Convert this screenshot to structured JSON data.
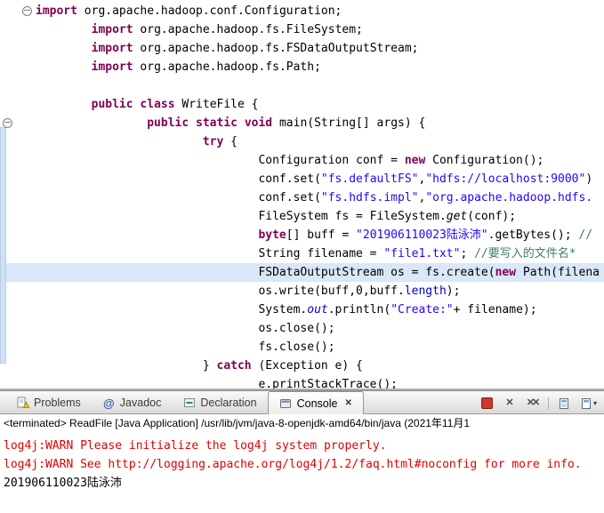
{
  "colors": {
    "kw": "#7f0055",
    "str": "#2a00ff",
    "com": "#3f7f5f",
    "stat": "#0000c0",
    "stderr": "#e00000",
    "stdout": "#000000",
    "hl": "#d9e7f8",
    "terminate": "#cc3b2e",
    "range": "#cfe0f4"
  },
  "editor": {
    "lines": [
      {
        "segments": [
          [
            "k",
            "import"
          ],
          [
            "p",
            " org.apache.hadoop.conf.Configuration;"
          ]
        ]
      },
      {
        "segments": [
          [
            "p",
            "        "
          ],
          [
            "k",
            "import"
          ],
          [
            "p",
            " org.apache.hadoop.fs.FileSystem;"
          ]
        ]
      },
      {
        "segments": [
          [
            "p",
            "        "
          ],
          [
            "k",
            "import"
          ],
          [
            "p",
            " org.apache.hadoop.fs.FSDataOutputStream;"
          ]
        ]
      },
      {
        "segments": [
          [
            "p",
            "        "
          ],
          [
            "k",
            "import"
          ],
          [
            "p",
            " org.apache.hadoop.fs.Path;"
          ]
        ]
      },
      {
        "segments": []
      },
      {
        "segments": [
          [
            "p",
            "        "
          ],
          [
            "k",
            "public"
          ],
          [
            "p",
            " "
          ],
          [
            "k",
            "class"
          ],
          [
            "p",
            " WriteFile {"
          ]
        ]
      },
      {
        "segments": [
          [
            "p",
            "                "
          ],
          [
            "k",
            "public"
          ],
          [
            "p",
            " "
          ],
          [
            "k",
            "static"
          ],
          [
            "p",
            " "
          ],
          [
            "k",
            "void"
          ],
          [
            "p",
            " main(String[] args) {"
          ]
        ]
      },
      {
        "segments": [
          [
            "p",
            "                        "
          ],
          [
            "k",
            "try"
          ],
          [
            "p",
            " {"
          ]
        ]
      },
      {
        "segments": [
          [
            "p",
            "                                Configuration conf = "
          ],
          [
            "k",
            "new"
          ],
          [
            "p",
            " Configuration();"
          ]
        ]
      },
      {
        "segments": [
          [
            "p",
            "                                conf.set("
          ],
          [
            "s",
            "\"fs.defaultFS\""
          ],
          [
            "p",
            ","
          ],
          [
            "s",
            "\"hdfs://localhost:9000\""
          ],
          [
            "p",
            ")"
          ]
        ]
      },
      {
        "segments": [
          [
            "p",
            "                                conf.set("
          ],
          [
            "s",
            "\"fs.hdfs.impl\""
          ],
          [
            "p",
            ","
          ],
          [
            "s",
            "\"org.apache.hadoop.hdfs."
          ]
        ]
      },
      {
        "segments": [
          [
            "p",
            "                                FileSystem fs = FileSystem."
          ],
          [
            "m",
            "get"
          ],
          [
            "p",
            "(conf);"
          ]
        ]
      },
      {
        "segments": [
          [
            "p",
            "                                "
          ],
          [
            "k",
            "byte"
          ],
          [
            "p",
            "[] buff = "
          ],
          [
            "s",
            "\"201906110023陆泳沛\""
          ],
          [
            "p",
            ".getBytes(); "
          ],
          [
            "c",
            "//"
          ]
        ]
      },
      {
        "segments": [
          [
            "p",
            "                                String filename = "
          ],
          [
            "s",
            "\"file1.txt\""
          ],
          [
            "p",
            "; "
          ],
          [
            "c",
            "//要写入的文件名*"
          ]
        ]
      },
      {
        "highlight": true,
        "segments": [
          [
            "p",
            "                                FSDataOutputStream os = fs.create("
          ],
          [
            "k",
            "new"
          ],
          [
            "p",
            " Path(filena"
          ]
        ]
      },
      {
        "segments": [
          [
            "p",
            "                                os.write(buff,0,buff."
          ],
          [
            "l",
            "length"
          ],
          [
            "p",
            ");"
          ]
        ]
      },
      {
        "segments": [
          [
            "p",
            "                                System."
          ],
          [
            "f",
            "out"
          ],
          [
            "p",
            ".println("
          ],
          [
            "s",
            "\"Create:\""
          ],
          [
            "p",
            "+ filename);"
          ]
        ]
      },
      {
        "segments": [
          [
            "p",
            "                                os.close();"
          ]
        ]
      },
      {
        "segments": [
          [
            "p",
            "                                fs.close();"
          ]
        ]
      },
      {
        "segments": [
          [
            "p",
            "                        } "
          ],
          [
            "k",
            "catch"
          ],
          [
            "p",
            " (Exception e) {"
          ]
        ]
      },
      {
        "segments": [
          [
            "p",
            "                                e.printStackTrace();"
          ]
        ]
      }
    ]
  },
  "panel": {
    "tabs": [
      {
        "label": "Problems"
      },
      {
        "label": "Javadoc"
      },
      {
        "label": "Declaration"
      },
      {
        "label": "Console",
        "active": true
      }
    ],
    "console": {
      "status_line": "<terminated> ReadFile [Java Application] /usr/lib/jvm/java-8-openjdk-amd64/bin/java (2021年11月1",
      "output": [
        {
          "stream": "stderr",
          "text": "log4j:WARN Please initialize the log4j system properly."
        },
        {
          "stream": "stderr",
          "text": "log4j:WARN See http://logging.apache.org/log4j/1.2/faq.html#noconfig for more info."
        },
        {
          "stream": "stdout",
          "text": "201906110023陆泳沛"
        }
      ]
    }
  }
}
